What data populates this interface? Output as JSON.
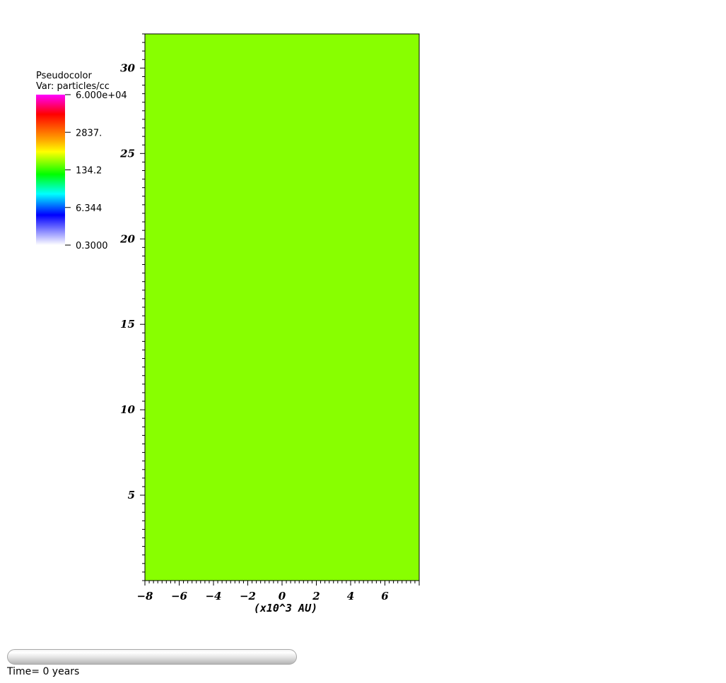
{
  "legend": {
    "title": "Pseudocolor",
    "var_label": "Var: particles/cc",
    "ticks": [
      "6.000e+04",
      "2837.",
      "134.2",
      "6.344",
      "0.3000"
    ],
    "colors": [
      "#ff00ff",
      "#ff0000",
      "#ffa500",
      "#ffff00",
      "#00ff00",
      "#00ffff",
      "#0000ff",
      "#ffffff"
    ]
  },
  "plot": {
    "fill_color": "#88ff00",
    "x_ticks": [
      "-8",
      "-6",
      "-4",
      "-2",
      "0",
      "2",
      "4",
      "6"
    ],
    "y_ticks": [
      "5",
      "10",
      "15",
      "20",
      "25",
      "30"
    ],
    "x_axis_title": "(x10^3  AU)"
  },
  "chart_data": {
    "type": "heatmap",
    "variable": "particles/cc",
    "colorbar_range": [
      0.3,
      60000
    ],
    "colorbar_scale": "log",
    "xlim": [
      -8,
      8
    ],
    "ylim": [
      0,
      32
    ],
    "x_unit": "x10^3 AU",
    "uniform_value_color": "#88ff00",
    "grid": false,
    "legend_position": "top-left"
  },
  "time": {
    "label": "Time= 0 years",
    "progress": 0
  }
}
